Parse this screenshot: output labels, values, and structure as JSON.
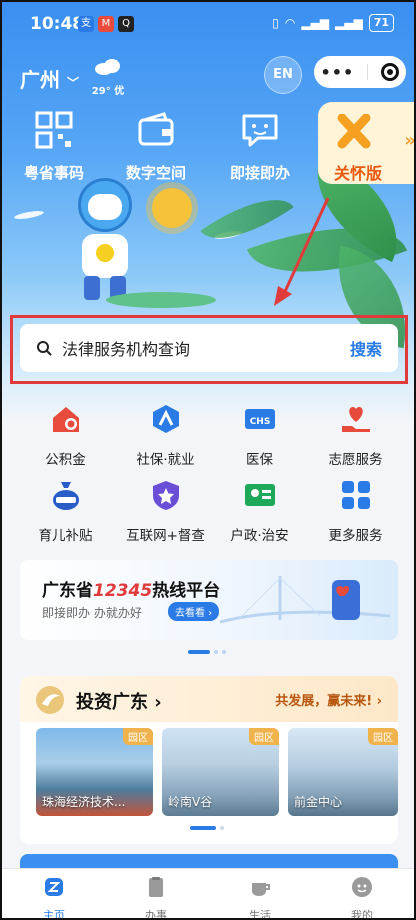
{
  "status": {
    "time": "10:48",
    "battery": "71"
  },
  "header": {
    "city": "广州",
    "weather": "29° 优",
    "lang_button": "EN"
  },
  "quick_entries": [
    {
      "label": "粤省事码",
      "icon": "qr-code-icon"
    },
    {
      "label": "数字空间",
      "icon": "wallet-icon"
    },
    {
      "label": "即接即办",
      "icon": "chat-icon"
    },
    {
      "label": "关怀版",
      "icon": "care-icon"
    }
  ],
  "search": {
    "placeholder": "法律服务机构查询",
    "button": "搜索"
  },
  "services": [
    {
      "label": "公积金",
      "color": "#e84a3c"
    },
    {
      "label": "社保·就业",
      "color": "#2a7be6"
    },
    {
      "label": "医保",
      "color": "#2a7be6"
    },
    {
      "label": "志愿服务",
      "color": "#e84a3c"
    },
    {
      "label": "育儿补贴",
      "color": "#2a5cc8"
    },
    {
      "label": "互联网+督查",
      "color": "#6a4fd6"
    },
    {
      "label": "户政·治安",
      "color": "#1ea85a"
    },
    {
      "label": "更多服务",
      "color": "#2a7be6"
    }
  ],
  "banner": {
    "title_prefix": "广东省",
    "title_number": "12345",
    "title_suffix": "热线平台",
    "subtitle": "即接即办 办就办好",
    "pill": "去看看 ›"
  },
  "invest": {
    "title": "投资广东",
    "chevron": "›",
    "slogan": "共发展，赢未来! ›",
    "parks": [
      {
        "tag": "园区",
        "name": "珠海经济技术..."
      },
      {
        "tag": "园区",
        "name": "岭南V谷"
      },
      {
        "tag": "园区",
        "name": "前金中心"
      }
    ]
  },
  "tabs": [
    {
      "label": "主页",
      "active": true
    },
    {
      "label": "办事",
      "active": false
    },
    {
      "label": "生活",
      "active": false
    },
    {
      "label": "我的",
      "active": false
    }
  ]
}
